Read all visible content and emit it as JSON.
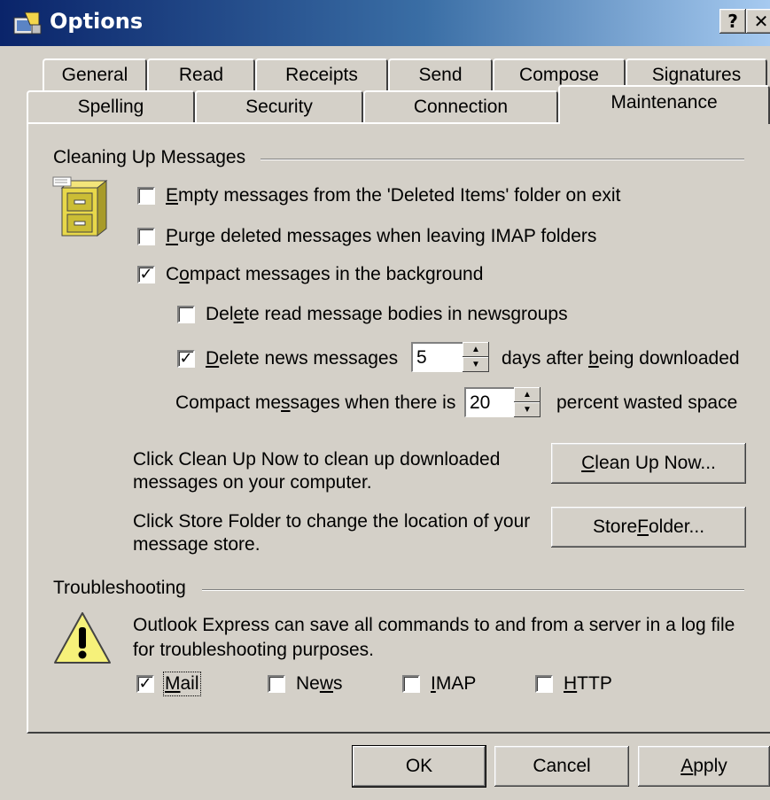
{
  "window": {
    "title": "Options",
    "help_button": "?",
    "close_button": "✕",
    "app_icon": "options-app-icon"
  },
  "tabs_row1": [
    "General",
    "Read",
    "Receipts",
    "Send",
    "Compose",
    "Signatures"
  ],
  "tabs_row2": [
    "Spelling",
    "Security",
    "Connection",
    "Maintenance"
  ],
  "active_tab": "Maintenance",
  "cleaning": {
    "group_label": "Cleaning Up Messages",
    "icon": "filing-cabinet-icon",
    "empty_deleted": {
      "label_pre": "",
      "accel": "E",
      "label_post": "mpty messages from the 'Deleted Items' folder on exit",
      "checked": false
    },
    "purge_imap": {
      "label_pre": "",
      "accel": "P",
      "label_post": "urge deleted messages when leaving IMAP folders",
      "checked": false
    },
    "compact_bg": {
      "label_pre": "C",
      "accel": "o",
      "label_post": "mpact messages in the background",
      "checked": true
    },
    "delete_read_bodies": {
      "label_pre": "Del",
      "accel": "e",
      "label_post": "te read message bodies in newsgroups",
      "checked": false
    },
    "delete_news": {
      "label_pre": "",
      "accel": "D",
      "label_post": "elete news messages",
      "checked": true,
      "days_value": "5",
      "suffix_pre": "days after ",
      "suffix_accel": "b",
      "suffix_post": "eing downloaded"
    },
    "compact_when": {
      "label_pre": "Compact me",
      "accel": "s",
      "label_post": "sages when there is",
      "percent_value": "20",
      "suffix": "percent wasted space"
    },
    "cleanup_desc_line1": "Click Clean Up Now to clean up downloaded",
    "cleanup_desc_line2": "messages on your computer.",
    "cleanup_button": {
      "pre": "",
      "accel": "C",
      "post": "lean Up Now..."
    },
    "store_desc_line1": "Click Store Folder to change the location of your",
    "store_desc_line2": "message store.",
    "store_button": {
      "pre": "Store ",
      "accel": "F",
      "post": "older..."
    }
  },
  "troubleshooting": {
    "group_label": "Troubleshooting",
    "icon": "warning-icon",
    "desc_line1": "Outlook Express can save all commands to and from a server in a log file",
    "desc_line2": "for troubleshooting purposes.",
    "mail": {
      "pre": "",
      "accel": "M",
      "post": "ail",
      "checked": true
    },
    "news": {
      "pre": "Ne",
      "accel": "w",
      "post": "s",
      "checked": false
    },
    "imap": {
      "pre": "",
      "accel": "I",
      "post": "MAP",
      "checked": false
    },
    "http": {
      "pre": "",
      "accel": "H",
      "post": "TTP",
      "checked": false
    }
  },
  "footer": {
    "ok": "OK",
    "cancel": "Cancel",
    "apply_pre": "",
    "apply_accel": "A",
    "apply_post": "pply"
  }
}
